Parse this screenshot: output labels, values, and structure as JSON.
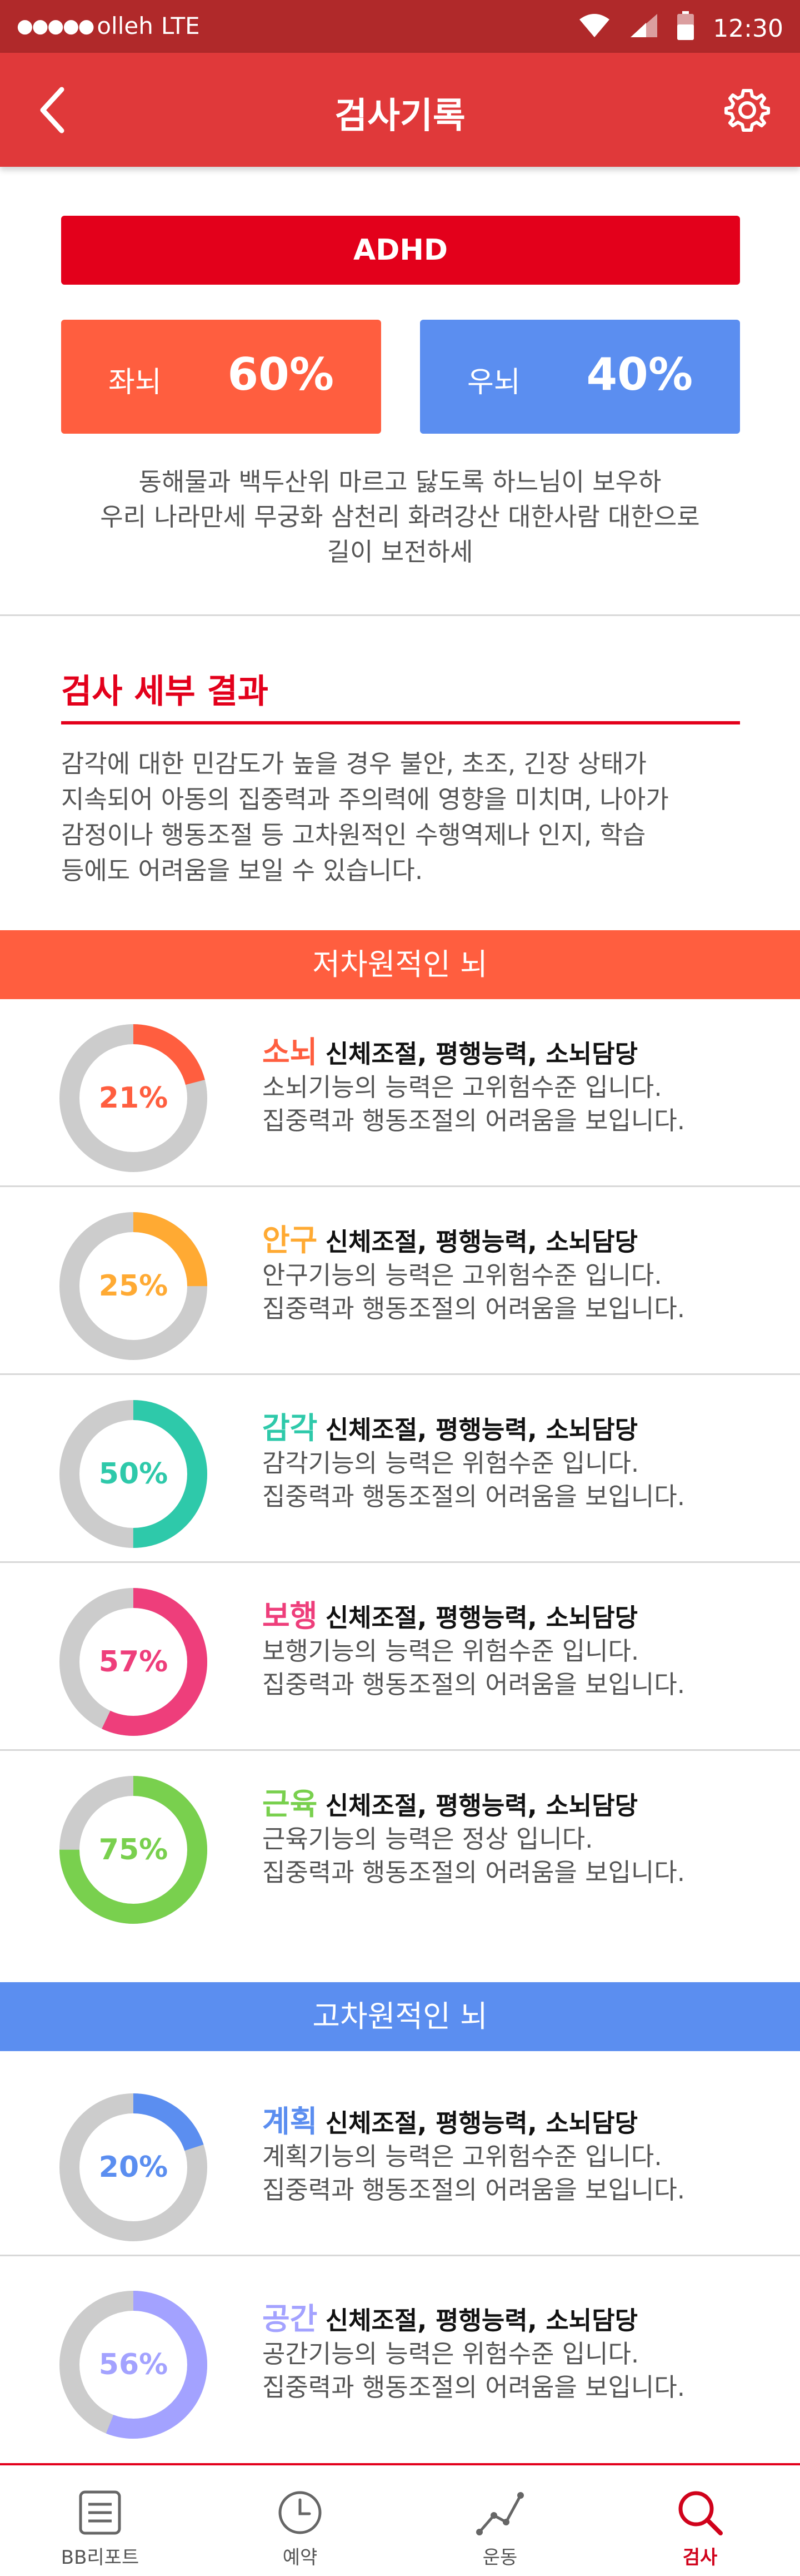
{
  "status_bar": {
    "carrier": "olleh",
    "network": "LTE",
    "time": "12:30",
    "signal_dots": "●●●●●"
  },
  "header": {
    "title": "검사기록",
    "back_icon": "chevron-left-icon",
    "settings_icon": "gear-icon"
  },
  "summary": {
    "diagnosis": "ADHD",
    "left_brain": {
      "label": "좌뇌",
      "percent": "60%",
      "color": "#ff5e3f"
    },
    "right_brain": {
      "label": "우뇌",
      "percent": "40%",
      "color": "#5b8ef0"
    },
    "text_lines": [
      "동해물과 백두산위 마르고 닳도록 하느님이 보우하",
      "우리 나라만세 무궁화 삼천리 화려강산 대한사람 대한으로",
      "길이 보전하세"
    ]
  },
  "detail": {
    "title": "검사 세부 결과",
    "text_lines": [
      "감각에 대한 민감도가 높을 경우 불안, 초조, 긴장 상태가",
      "지속되어 아동의 집중력과 주의력에 영향을 미치며, 나아가",
      "감정이나 행동조절 등 고차원적인 수행역제나 인지, 학습",
      "등에도 어려움을 보일 수 있습니다."
    ]
  },
  "sections": {
    "low": {
      "title": "저차원적인 뇌",
      "color": "#ff5e3f"
    },
    "high": {
      "title": "고차원적인 뇌",
      "color": "#5b8ef0"
    }
  },
  "items": [
    {
      "name": "소뇌",
      "tags": "신체조절, 평행능력, 소뇌담당",
      "line1": "소뇌기능의 능력은 고위험수준 입니다.",
      "line2": "집중력과 행동조절의 어려움을 보입니다.",
      "percent_label": "21%",
      "value": 21,
      "color": "#ff5e3f"
    },
    {
      "name": "안구",
      "tags": "신체조절, 평행능력, 소뇌담당",
      "line1": "안구기능의 능력은 고위험수준 입니다.",
      "line2": "집중력과 행동조절의 어려움을 보입니다.",
      "percent_label": "25%",
      "value": 25,
      "color": "#ffaa33"
    },
    {
      "name": "감각",
      "tags": "신체조절, 평행능력, 소뇌담당",
      "line1": "감각기능의 능력은 위험수준 입니다.",
      "line2": "집중력과 행동조절의 어려움을 보입니다.",
      "percent_label": "50%",
      "value": 50,
      "color": "#2ec9aa"
    },
    {
      "name": "보행",
      "tags": "신체조절, 평행능력, 소뇌담당",
      "line1": "보행기능의 능력은 위험수준 입니다.",
      "line2": "집중력과 행동조절의 어려움을 보입니다.",
      "percent_label": "57%",
      "value": 57,
      "color": "#ee3e7b"
    },
    {
      "name": "근육",
      "tags": "신체조절, 평행능력, 소뇌담당",
      "line1": "근육기능의 능력은 정상 입니다.",
      "line2": "집중력과 행동조절의 어려움을 보입니다.",
      "percent_label": "75%",
      "value": 75,
      "color": "#79d04e"
    },
    {
      "name": "계획",
      "tags": "신체조절, 평행능력, 소뇌담당",
      "line1": "계획기능의 능력은 고위험수준 입니다.",
      "line2": "집중력과 행동조절의 어려움을 보입니다.",
      "percent_label": "20%",
      "value": 20,
      "color": "#5b8ef0"
    },
    {
      "name": "공간",
      "tags": "신체조절, 평행능력, 소뇌담당",
      "line1": "공간기능의 능력은 위험수준 입니다.",
      "line2": "집중력과 행동조절의 어려움을 보입니다.",
      "percent_label": "56%",
      "value": 56,
      "color": "#a3a2ff"
    }
  ],
  "bottom_nav": [
    {
      "label": "BB리포트",
      "icon": "report-icon",
      "active": false
    },
    {
      "label": "예약",
      "icon": "clock-icon",
      "active": false
    },
    {
      "label": "운동",
      "icon": "exercise-graph-icon",
      "active": false
    },
    {
      "label": "검사",
      "icon": "search-icon",
      "active": true
    }
  ],
  "colors": {
    "status_bar": "#b0292a",
    "app_bar": "#e0393a",
    "accent": "#e3001b",
    "donut_track": "#cccccc"
  }
}
